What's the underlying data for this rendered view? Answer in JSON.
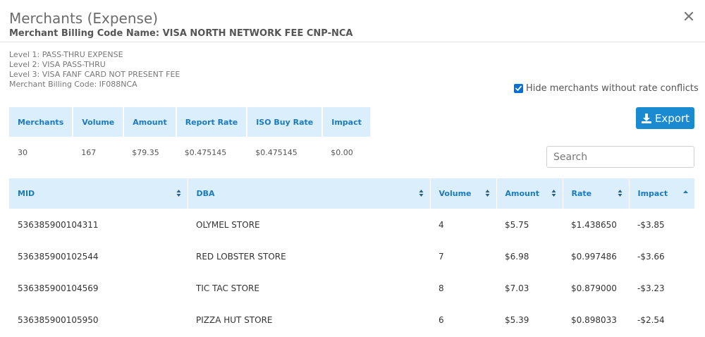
{
  "modal": {
    "title": "Merchants (Expense)",
    "subtitle": "Merchant Billing Code Name: VISA NORTH NETWORK FEE CNP-NCA"
  },
  "levels": [
    "Level 1: PASS-THRU EXPENSE",
    "Level 2: VISA PASS-THRU",
    "Level 3: VISA FANF CARD NOT PRESENT FEE",
    "Merchant Billing Code: IF088NCA"
  ],
  "hide_toggle": {
    "label": "Hide merchants without rate conflicts",
    "checked": true
  },
  "export": {
    "label": "Export"
  },
  "summary": {
    "headers": [
      "Merchants",
      "Volume",
      "Amount",
      "Report Rate",
      "ISO Buy Rate",
      "Impact"
    ],
    "values": [
      "30",
      "167",
      "$79.35",
      "$0.475145",
      "$0.475145",
      "$0.00"
    ]
  },
  "search": {
    "placeholder": "Search",
    "value": ""
  },
  "table": {
    "headers": [
      "MID",
      "DBA",
      "Volume",
      "Amount",
      "Rate",
      "Impact"
    ],
    "sort_active": "Impact",
    "rows": [
      [
        "536385900104311",
        "OLYMEL STORE",
        "4",
        "$5.75",
        "$1.438650",
        "-$3.85"
      ],
      [
        "536385900102544",
        "RED LOBSTER STORE",
        "7",
        "$6.98",
        "$0.997486",
        "-$3.66"
      ],
      [
        "536385900104569",
        "TIC TAC STORE",
        "8",
        "$7.03",
        "$0.879000",
        "-$3.23"
      ],
      [
        "536385900105950",
        "PIZZA HUT STORE",
        "6",
        "$5.39",
        "$0.898033",
        "-$2.54"
      ]
    ]
  },
  "colors": {
    "accent": "#1a8bd0",
    "header_bg": "#dbeefb",
    "header_text": "#1a7bbf"
  }
}
